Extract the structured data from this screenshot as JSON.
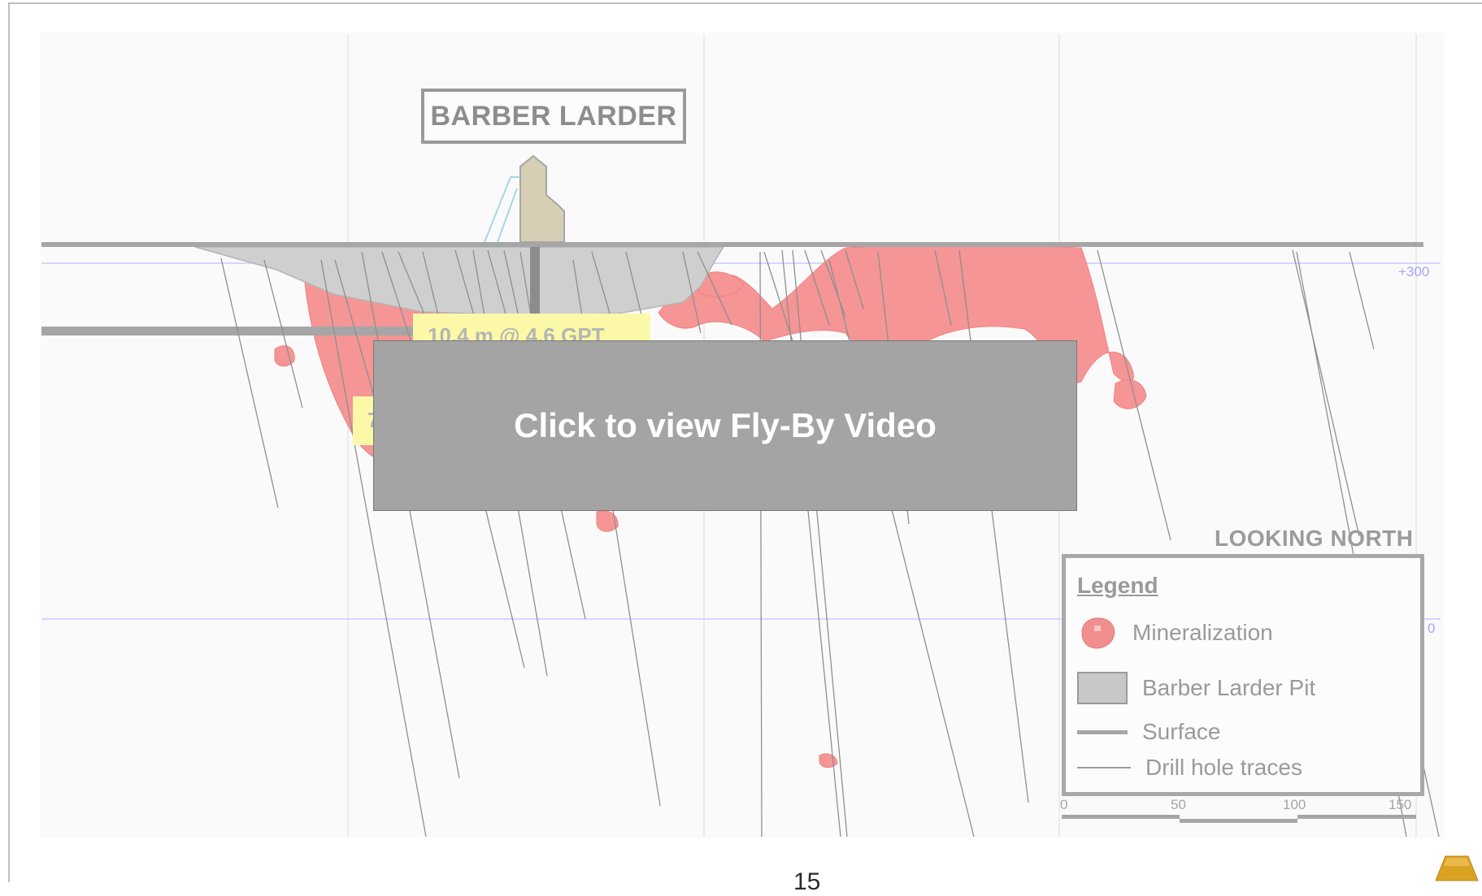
{
  "diagram": {
    "title": "BARBER LARDER",
    "intercepts": [
      "10.4 m @ 4.6 GPT",
      "7"
    ],
    "elevations": [
      "+300",
      "0"
    ],
    "orientation": "LOOKING NORTH",
    "legend": {
      "title": "Legend",
      "items": [
        {
          "label": "Mineralization",
          "symbol": "mineralization-blob",
          "color": "#f08080"
        },
        {
          "label": "Barber Larder Pit",
          "symbol": "grey-box",
          "color": "#c8c8c8"
        },
        {
          "label": "Surface",
          "symbol": "thick-line",
          "color": "#a6a6a6"
        },
        {
          "label": "Drill hole traces",
          "symbol": "thin-line",
          "color": "#9d9d9d"
        }
      ]
    },
    "scale_ticks": [
      "0",
      "50",
      "100",
      "150"
    ]
  },
  "video": {
    "label": "Click to view Fly-By Video",
    "background": "#a4a4a4"
  },
  "footer": {
    "page_number": "15",
    "logo_icon": "gold-bar-icon",
    "logo_color": "#d9a321"
  }
}
